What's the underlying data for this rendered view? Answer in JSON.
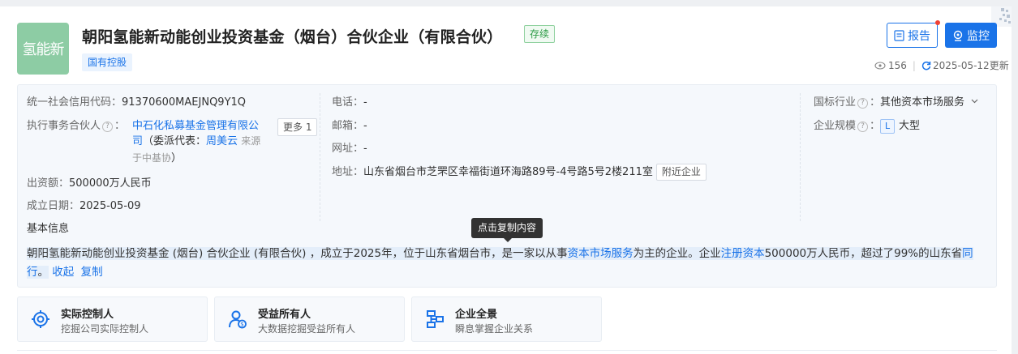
{
  "company": {
    "logo_text": "氢能新",
    "name": "朝阳氢能新动能创业投资基金（烟台）合伙企业（有限合伙）",
    "status": "存续",
    "tag": "国有控股"
  },
  "actions": {
    "report_label": "报告",
    "monitor_label": "监控",
    "view_count": "156",
    "updated": "2025-05-12更新"
  },
  "info": {
    "credit_code_label": "统一社会信用代码：",
    "credit_code": "91370600MAEJNQ9Y1Q",
    "partner_label": "执行事务合伙人",
    "partner_name_line1": "中石化私募基金管理有限公",
    "partner_name_line2": "司",
    "delegate_prefix": "（委派代表：",
    "delegate_name": "周美云",
    "source_line1": "来源",
    "source_line2": "于中基协",
    "delegate_suffix": "）",
    "more_label": "更多 1",
    "capital_label": "出资额：",
    "capital": "500000万人民币",
    "date_label": "成立日期：",
    "date": "2025-05-09",
    "phone_label": "电话：",
    "phone": "-",
    "email_label": "邮箱：",
    "email": "-",
    "website_label": "网址：",
    "website": "-",
    "address_label": "地址：",
    "address": "山东省烟台市芝罘区幸福街道环海路89号-4号路5号2楼211室",
    "nearby_label": "附近企业",
    "industry_label": "国标行业",
    "industry": "其他资本市场服务",
    "scale_label": "企业规模",
    "scale_badge": "L",
    "scale": "大型"
  },
  "basic": {
    "heading": "基本信息",
    "text_1": "朝阳氢能新动能创业投资基金 (烟台) 合伙企业 (有限合伙) ，成立于2025年，位于山东省烟台市，是一家以从事",
    "link_1": "资本市场服务",
    "text_2": "为主的企业。企业",
    "link_2": "注册资本",
    "text_3": "500000万人民币，超过了99%的山东省",
    "link_3": "同行",
    "text_4": "。",
    "collapse": "收起",
    "copy": "复制",
    "tooltip": "点击复制内容"
  },
  "features": [
    {
      "title": "实际控制人",
      "subtitle": "挖掘公司实际控制人",
      "icon": "target-icon"
    },
    {
      "title": "受益所有人",
      "subtitle": "大数据挖掘受益所有人",
      "icon": "beneficiary-icon"
    },
    {
      "title": "企业全景",
      "subtitle": "瞬息掌握企业关系",
      "icon": "org-chart-icon"
    }
  ],
  "colors": {
    "accent": "#1a73e8",
    "logo_bg": "#8dcca4",
    "status_green": "#2b9b45"
  }
}
